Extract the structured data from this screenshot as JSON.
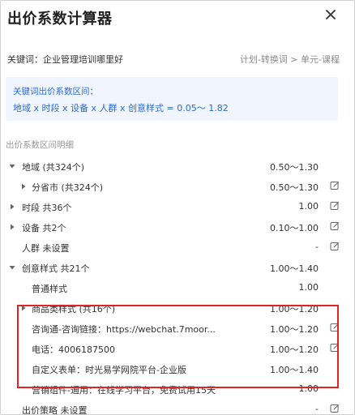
{
  "dialog": {
    "title": "出价系数计算器"
  },
  "keyword": {
    "text": "关键词：企业管理培训哪里好",
    "breadcrumb": "计划-转换词 > 单元-课程"
  },
  "info": {
    "line1": "关键词出价系数区间：",
    "line2": "地域 x 时段 x 设备 x 人群 x 创意样式 = 0.05～ 1.82"
  },
  "section_label": "出价系数区间明细",
  "rows": [
    {
      "label": "地域 (共324个)",
      "value": "0.50～1.30",
      "caret": "down",
      "indent": 0,
      "editable": false
    },
    {
      "label": "分省市 (共324个)",
      "value": "0.50～1.30",
      "caret": "right",
      "indent": 1,
      "editable": true
    },
    {
      "label": "时段 共36个",
      "value": "1.00",
      "caret": "right",
      "indent": 0,
      "editable": true
    },
    {
      "label": "设备 共2个",
      "value": "0.10～1.00",
      "caret": "right",
      "indent": 0,
      "editable": true
    },
    {
      "label": "人群 未设置",
      "value": "-",
      "caret": "none",
      "indent": 0,
      "editable": true
    },
    {
      "label": "创意样式 共21个",
      "value": "1.00～1.40",
      "caret": "down",
      "indent": 0,
      "editable": false
    },
    {
      "label": "普通样式",
      "value": "1.00",
      "caret": "none",
      "indent": 1,
      "editable": false
    },
    {
      "label": "商品类样式 (共16个)",
      "value": "1.00～1.20",
      "caret": "right",
      "indent": 1,
      "editable": false
    },
    {
      "label": "咨询通-咨询链接：https://webchat.7moor...",
      "value": "1.00～1.20",
      "caret": "none",
      "indent": 1,
      "editable": true
    },
    {
      "label": "电话：4006187500",
      "value": "1.00～1.20",
      "caret": "none",
      "indent": 1,
      "editable": true
    },
    {
      "label": "自定义表单：时光易学网院平台-企业版",
      "value": "1.00～1.40",
      "caret": "none",
      "indent": 1,
      "editable": false
    },
    {
      "label": "营销组件-通用：在线学习平台，免费试用15天",
      "value": "1.00",
      "caret": "none",
      "indent": 1,
      "editable": false
    },
    {
      "label": "出价策略 未设置",
      "value": "-",
      "caret": "none",
      "indent": 0,
      "editable": true
    }
  ],
  "colors": {
    "accent": "#2a6bd8",
    "info_bg": "#f1f6fe",
    "highlight_border": "#e02424",
    "muted_text": "#999999"
  },
  "icons": {
    "close": "close-icon",
    "edit": "edit-icon",
    "caret_down": "caret-down-icon",
    "caret_right": "caret-right-icon"
  }
}
